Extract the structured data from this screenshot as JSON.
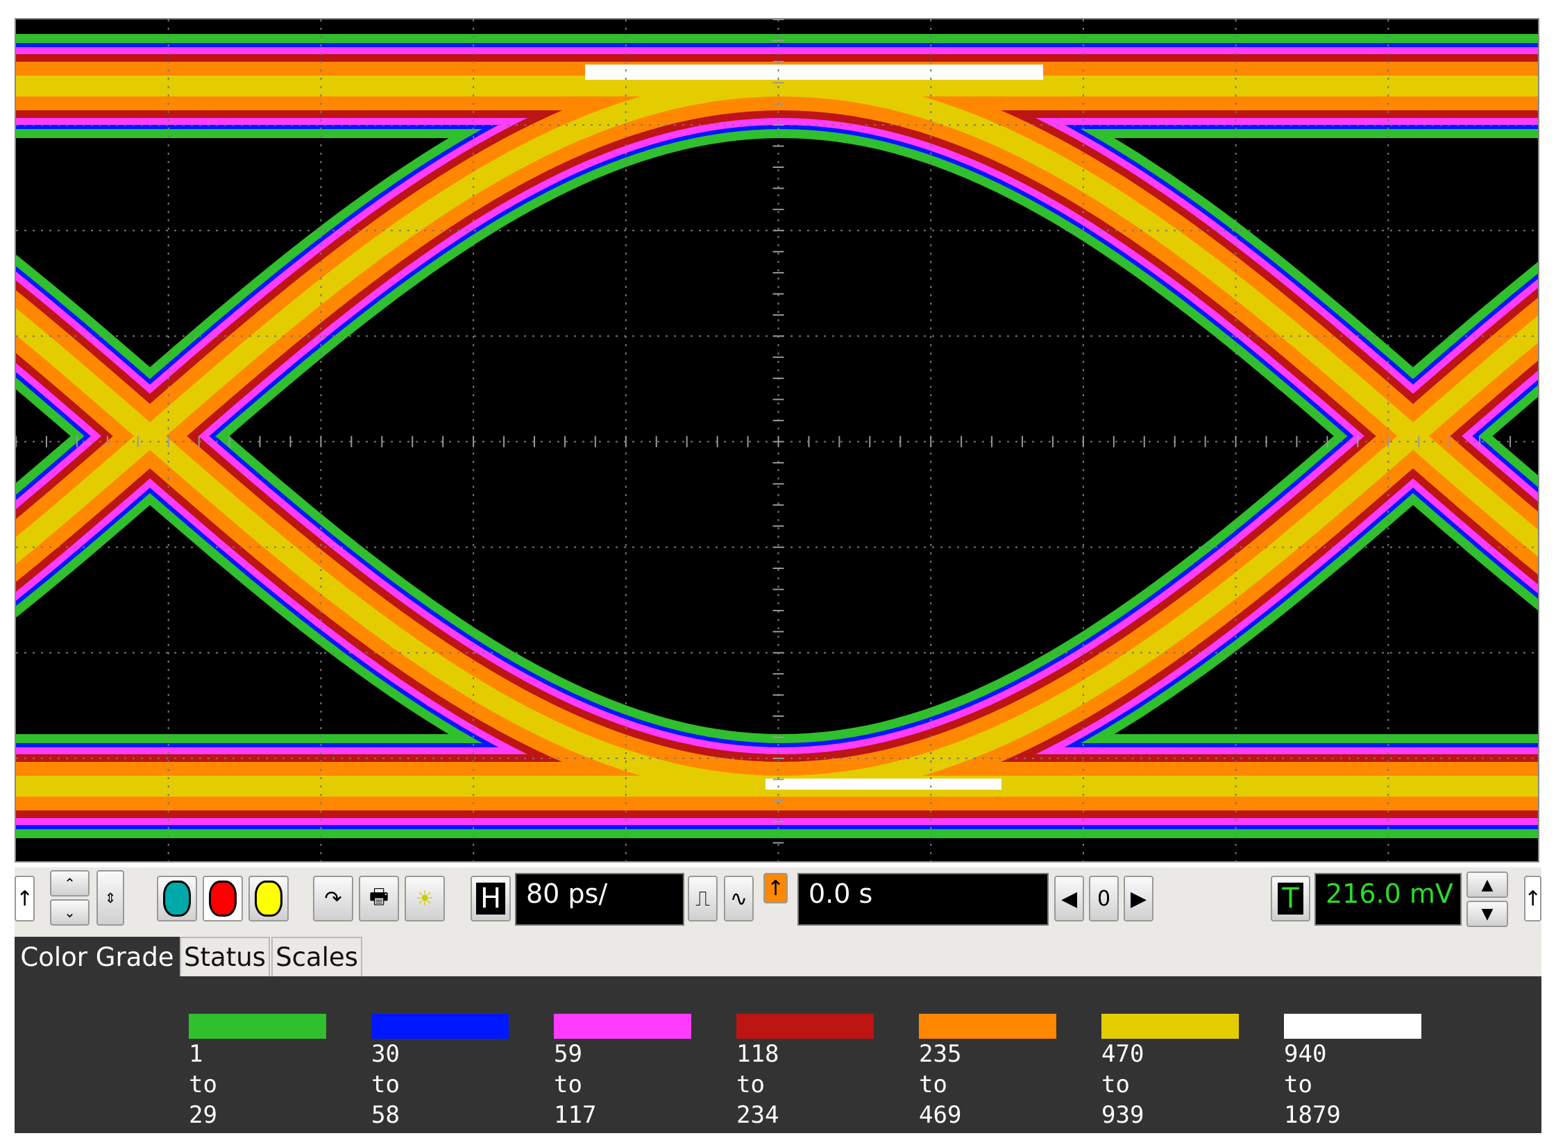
{
  "scope": {
    "grid": {
      "hdiv": 10,
      "vdiv": 8
    },
    "eye_colors": [
      "#30bf2d",
      "#0018ff",
      "#ff3cff",
      "#bd1414",
      "#ff8800",
      "#e3cd00",
      "#ffffff"
    ]
  },
  "toolbar": {
    "timebase_label": "H",
    "timebase_value": "80 ps/",
    "position_value": "0.0 s",
    "position_step": "0",
    "trigger_label": "T",
    "trigger_level": "216.0 mV"
  },
  "tabs": [
    {
      "label": "Color Grade",
      "active": true
    },
    {
      "label": "Status",
      "active": false
    },
    {
      "label": "Scales",
      "active": false
    }
  ],
  "legend": [
    {
      "color": "#30bf2d",
      "from": "1",
      "to_word": "to",
      "to": "29"
    },
    {
      "color": "#0018ff",
      "from": "30",
      "to_word": "to",
      "to": "58"
    },
    {
      "color": "#ff3cff",
      "from": "59",
      "to_word": "to",
      "to": "117"
    },
    {
      "color": "#bd1414",
      "from": "118",
      "to_word": "to",
      "to": "234"
    },
    {
      "color": "#ff8800",
      "from": "235",
      "to_word": "to",
      "to": "469"
    },
    {
      "color": "#e3cd00",
      "from": "470",
      "to_word": "to",
      "to": "939"
    },
    {
      "color": "#ffffff",
      "from": "940",
      "to_word": "to",
      "to": "1879"
    }
  ]
}
